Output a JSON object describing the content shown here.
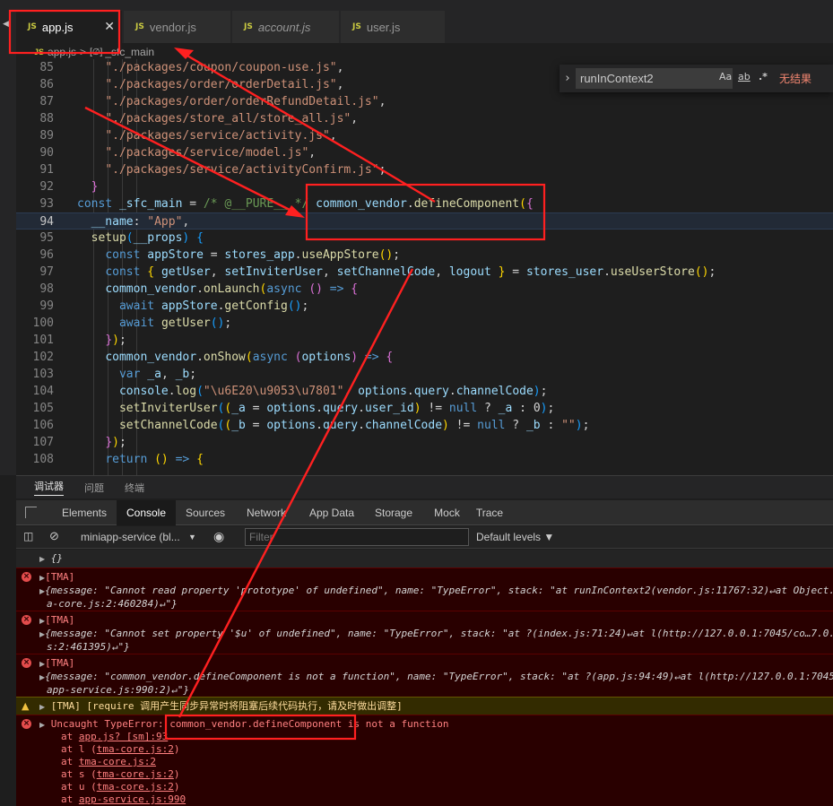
{
  "tabs": [
    {
      "label": "app.js",
      "active": true,
      "italic": false
    },
    {
      "label": "vendor.js",
      "active": false,
      "italic": false
    },
    {
      "label": "account.js",
      "active": false,
      "italic": true
    },
    {
      "label": "user.js",
      "active": false,
      "italic": false
    }
  ],
  "tab_badge": "JS",
  "tab_close_glyph": "✕",
  "breadcrumb": {
    "file": "app.js",
    "separator": ">",
    "symbol_icon": "[∅]",
    "symbol": "_sfc_main"
  },
  "find": {
    "value": "runInContext2",
    "match_case": "Aa",
    "whole_word": "ab",
    "regex": ".*",
    "result": "无结果"
  },
  "editor": {
    "lines": [
      {
        "n": "85",
        "segs": [
          [
            "    ",
            "pun"
          ],
          [
            "\"./packages/coupon/coupon-use.js\"",
            "str"
          ],
          [
            ",",
            "pun"
          ]
        ]
      },
      {
        "n": "86",
        "segs": [
          [
            "    ",
            "pun"
          ],
          [
            "\"./packages/order/orderDetail.js\"",
            "str"
          ],
          [
            ",",
            "pun"
          ]
        ]
      },
      {
        "n": "87",
        "segs": [
          [
            "    ",
            "pun"
          ],
          [
            "\"./packages/order/orderRefundDetail.js\"",
            "str"
          ],
          [
            ",",
            "pun"
          ]
        ]
      },
      {
        "n": "88",
        "segs": [
          [
            "    ",
            "pun"
          ],
          [
            "\"./packages/store_all/store_all.js\"",
            "str"
          ],
          [
            ",",
            "pun"
          ]
        ]
      },
      {
        "n": "89",
        "segs": [
          [
            "    ",
            "pun"
          ],
          [
            "\"./packages/service/activity.js\"",
            "str"
          ],
          [
            ",",
            "pun"
          ]
        ]
      },
      {
        "n": "90",
        "segs": [
          [
            "    ",
            "pun"
          ],
          [
            "\"./packages/service/model.js\"",
            "str"
          ],
          [
            ",",
            "pun"
          ]
        ]
      },
      {
        "n": "91",
        "segs": [
          [
            "    ",
            "pun"
          ],
          [
            "\"./packages/service/activityConfirm.js\"",
            "str"
          ],
          [
            ";",
            "pun"
          ]
        ]
      },
      {
        "n": "92",
        "segs": [
          [
            "  ",
            "pun"
          ],
          [
            "}",
            "b2"
          ]
        ]
      },
      {
        "n": "93",
        "segs": [
          [
            "const ",
            "kw"
          ],
          [
            "_sfc_main",
            "var"
          ],
          [
            " = ",
            "pun"
          ],
          [
            "/* @__PURE__ */",
            "cm"
          ],
          [
            " ",
            "pun"
          ],
          [
            "common_vendor",
            "var"
          ],
          [
            ".",
            "pun"
          ],
          [
            "defineComponent",
            "fn"
          ],
          [
            "(",
            "b1"
          ],
          [
            "{",
            "b2"
          ]
        ]
      },
      {
        "n": "94",
        "segs": [
          [
            "  ",
            "pun"
          ],
          [
            "__name",
            "var"
          ],
          [
            ": ",
            "pun"
          ],
          [
            "\"App\"",
            "str"
          ],
          [
            ",",
            "pun"
          ]
        ],
        "current": true
      },
      {
        "n": "95",
        "segs": [
          [
            "  ",
            "pun"
          ],
          [
            "setup",
            "fn"
          ],
          [
            "(",
            "b3"
          ],
          [
            "__props",
            "var"
          ],
          [
            ")",
            "b3"
          ],
          [
            " ",
            "pun"
          ],
          [
            "{",
            "b3"
          ]
        ]
      },
      {
        "n": "96",
        "segs": [
          [
            "    ",
            "pun"
          ],
          [
            "const ",
            "kw"
          ],
          [
            "appStore",
            "var"
          ],
          [
            " = ",
            "pun"
          ],
          [
            "stores_app",
            "var"
          ],
          [
            ".",
            "pun"
          ],
          [
            "useAppStore",
            "fn"
          ],
          [
            "()",
            "b1"
          ],
          [
            ";",
            "pun"
          ]
        ]
      },
      {
        "n": "97",
        "segs": [
          [
            "    ",
            "pun"
          ],
          [
            "const ",
            "kw"
          ],
          [
            "{ ",
            "b1"
          ],
          [
            "getUser",
            "var"
          ],
          [
            ", ",
            "pun"
          ],
          [
            "setInviterUser",
            "var"
          ],
          [
            ", ",
            "pun"
          ],
          [
            "setChannelCode",
            "var"
          ],
          [
            ", ",
            "pun"
          ],
          [
            "logout",
            "var"
          ],
          [
            " }",
            "b1"
          ],
          [
            " = ",
            "pun"
          ],
          [
            "stores_user",
            "var"
          ],
          [
            ".",
            "pun"
          ],
          [
            "useUserStore",
            "fn"
          ],
          [
            "()",
            "b1"
          ],
          [
            ";",
            "pun"
          ]
        ]
      },
      {
        "n": "98",
        "segs": [
          [
            "    ",
            "pun"
          ],
          [
            "common_vendor",
            "var"
          ],
          [
            ".",
            "pun"
          ],
          [
            "onLaunch",
            "fn"
          ],
          [
            "(",
            "b1"
          ],
          [
            "async ",
            "kw"
          ],
          [
            "()",
            "b2"
          ],
          [
            " => ",
            "kw"
          ],
          [
            "{",
            "b2"
          ]
        ]
      },
      {
        "n": "99",
        "segs": [
          [
            "      ",
            "pun"
          ],
          [
            "await ",
            "kw"
          ],
          [
            "appStore",
            "var"
          ],
          [
            ".",
            "pun"
          ],
          [
            "getConfig",
            "fn"
          ],
          [
            "()",
            "b3"
          ],
          [
            ";",
            "pun"
          ]
        ]
      },
      {
        "n": "100",
        "segs": [
          [
            "      ",
            "pun"
          ],
          [
            "await ",
            "kw"
          ],
          [
            "getUser",
            "fn"
          ],
          [
            "()",
            "b3"
          ],
          [
            ";",
            "pun"
          ]
        ]
      },
      {
        "n": "101",
        "segs": [
          [
            "    ",
            "pun"
          ],
          [
            "}",
            "b2"
          ],
          [
            ")",
            "b1"
          ],
          [
            ";",
            "pun"
          ]
        ]
      },
      {
        "n": "102",
        "segs": [
          [
            "    ",
            "pun"
          ],
          [
            "common_vendor",
            "var"
          ],
          [
            ".",
            "pun"
          ],
          [
            "onShow",
            "fn"
          ],
          [
            "(",
            "b1"
          ],
          [
            "async ",
            "kw"
          ],
          [
            "(",
            "b2"
          ],
          [
            "options",
            "var"
          ],
          [
            ")",
            "b2"
          ],
          [
            " => ",
            "kw"
          ],
          [
            "{",
            "b2"
          ]
        ]
      },
      {
        "n": "103",
        "segs": [
          [
            "      ",
            "pun"
          ],
          [
            "var ",
            "kw"
          ],
          [
            "_a",
            "var"
          ],
          [
            ", ",
            "pun"
          ],
          [
            "_b",
            "var"
          ],
          [
            ";",
            "pun"
          ]
        ]
      },
      {
        "n": "104",
        "segs": [
          [
            "      ",
            "pun"
          ],
          [
            "console",
            "var"
          ],
          [
            ".",
            "pun"
          ],
          [
            "log",
            "fn"
          ],
          [
            "(",
            "b3"
          ],
          [
            "\"\\u6E20\\u9053\\u7801\"",
            "str"
          ],
          [
            ", ",
            "pun"
          ],
          [
            "options",
            "var"
          ],
          [
            ".",
            "pun"
          ],
          [
            "query",
            "var"
          ],
          [
            ".",
            "pun"
          ],
          [
            "channelCode",
            "var"
          ],
          [
            ")",
            "b3"
          ],
          [
            ";",
            "pun"
          ]
        ]
      },
      {
        "n": "105",
        "segs": [
          [
            "      ",
            "pun"
          ],
          [
            "setInviterUser",
            "fn"
          ],
          [
            "(",
            "b3"
          ],
          [
            "(",
            "b1"
          ],
          [
            "_a",
            "var"
          ],
          [
            " = ",
            "pun"
          ],
          [
            "options",
            "var"
          ],
          [
            ".",
            "pun"
          ],
          [
            "query",
            "var"
          ],
          [
            ".",
            "pun"
          ],
          [
            "user_id",
            "var"
          ],
          [
            ")",
            "b1"
          ],
          [
            " != ",
            "pun"
          ],
          [
            "null",
            "kw"
          ],
          [
            " ? ",
            "pun"
          ],
          [
            "_a",
            "var"
          ],
          [
            " : ",
            "pun"
          ],
          [
            "0",
            "pun"
          ],
          [
            ")",
            "b3"
          ],
          [
            ";",
            "pun"
          ]
        ]
      },
      {
        "n": "106",
        "segs": [
          [
            "      ",
            "pun"
          ],
          [
            "setChannelCode",
            "fn"
          ],
          [
            "(",
            "b3"
          ],
          [
            "(",
            "b1"
          ],
          [
            "_b",
            "var"
          ],
          [
            " = ",
            "pun"
          ],
          [
            "options",
            "var"
          ],
          [
            ".",
            "pun"
          ],
          [
            "query",
            "var"
          ],
          [
            ".",
            "pun"
          ],
          [
            "channelCode",
            "var"
          ],
          [
            ")",
            "b1"
          ],
          [
            " != ",
            "pun"
          ],
          [
            "null",
            "kw"
          ],
          [
            " ? ",
            "pun"
          ],
          [
            "_b",
            "var"
          ],
          [
            " : ",
            "pun"
          ],
          [
            "\"\"",
            "str"
          ],
          [
            ")",
            "b3"
          ],
          [
            ";",
            "pun"
          ]
        ]
      },
      {
        "n": "107",
        "segs": [
          [
            "    ",
            "pun"
          ],
          [
            "}",
            "b2"
          ],
          [
            ")",
            "b1"
          ],
          [
            ";",
            "pun"
          ]
        ]
      },
      {
        "n": "108",
        "segs": [
          [
            "    ",
            "pun"
          ],
          [
            "return ",
            "kw"
          ],
          [
            "()",
            "b1"
          ],
          [
            " => ",
            "kw"
          ],
          [
            "{",
            "b1"
          ]
        ]
      }
    ]
  },
  "panel_tabs": [
    "调试器",
    "问题",
    "终端"
  ],
  "devtools_tabs": [
    "Elements",
    "Console",
    "Sources",
    "Network",
    "App Data",
    "Storage",
    "Mock",
    "Trace"
  ],
  "console_toolbar": {
    "context": "miniapp-service (bl...",
    "context_caret": "▼",
    "filter_placeholder": "Filter",
    "levels": "Default levels ▼"
  },
  "console": {
    "empty_obj": "{}",
    "err_icon": "×",
    "warn_icon": "▲",
    "tri": "▶",
    "tag": "[TMA]",
    "errors": [
      {
        "line1": "{message: \"Cannot read property 'prototype' of undefined\", name: \"TypeError\", stack: \"at runInContext2(vendor.js:11767:32)↵at Object.",
        "line2": "a-core.js:2:460284)↵\"}"
      },
      {
        "line1": "{message: \"Cannot set property '$u' of undefined\", name: \"TypeError\", stack: \"at ?(index.js:71:24)↵at l(http://127.0.0.1:7045/co…7.0.",
        "line2": "s:2:461395)↵\"}"
      },
      {
        "line1": "{message: \"common_vendor.defineComponent is not a function\", name: \"TypeError\", stack: \"at ?(app.js:94:49)↵at l(http://127.0.0.1:7045",
        "line2": "app-service.js:990:2)↵\"}"
      }
    ],
    "warning": "[TMA] [require 调用产生同步异常时将阻塞后续代码执行，请及时做出调整]",
    "uncaught": "Uncaught TypeError: common_vendor.defineComponent is not a function",
    "trace": [
      {
        "prefix": "at ",
        "link": "app.js? [sm]:93",
        "suffix": ""
      },
      {
        "prefix": "at l (",
        "link": "tma-core.js:2",
        "suffix": ")"
      },
      {
        "prefix": "at ",
        "link": "tma-core.js:2",
        "suffix": ""
      },
      {
        "prefix": "at s (",
        "link": "tma-core.js:2",
        "suffix": ")"
      },
      {
        "prefix": "at u (",
        "link": "tma-core.js:2",
        "suffix": ")"
      },
      {
        "prefix": "at ",
        "link": "app-service.js:990",
        "suffix": ""
      }
    ]
  },
  "colors": {
    "annotation": "#ff2020",
    "find_no_result": "#f48771",
    "error_bg": "#290000",
    "warning_bg": "#332b00"
  }
}
